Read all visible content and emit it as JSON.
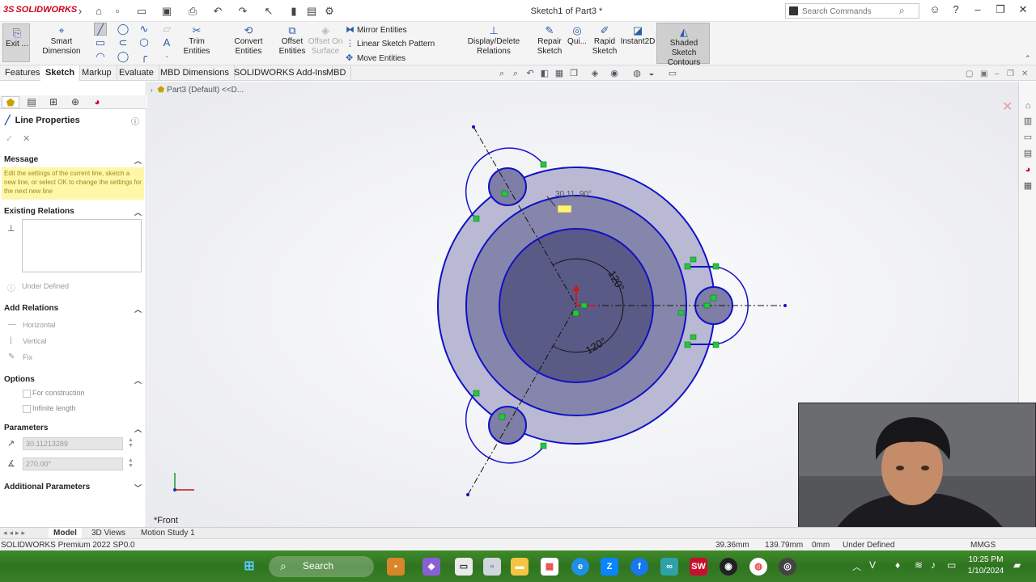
{
  "app": {
    "brand": "SOLIDWORKS",
    "document_title": "Sketch1 of Part3 *",
    "search_placeholder": "Search Commands"
  },
  "ribbon": {
    "exit_label": "Exit ...",
    "smart_dimension": "Smart Dimension",
    "trim_entities": "Trim Entities",
    "convert_entities": "Convert Entities",
    "offset_entities_line1": "Offset",
    "offset_entities_line2": "Entities",
    "offset_on_line1": "Offset On",
    "offset_on_line2": "Surface",
    "mirror_entities": "Mirror Entities",
    "linear_sketch_pattern": "Linear Sketch Pattern",
    "move_entities": "Move Entities",
    "display_delete_relations": "Display/Delete Relations",
    "repair_line1": "Repair",
    "repair_line2": "Sketch",
    "quick": "Qui...",
    "rapid_line1": "Rapid",
    "rapid_line2": "Sketch",
    "instant2d": "Instant2D",
    "shaded_line1": "Shaded Sketch",
    "shaded_line2": "Contours"
  },
  "tabs": [
    "Features",
    "Sketch",
    "Markup",
    "Evaluate",
    "MBD Dimensions",
    "SOLIDWORKS Add-Ins",
    "MBD"
  ],
  "active_tab": "Sketch",
  "tree": {
    "root": "Part3 (Default) <<D..."
  },
  "property_manager": {
    "title": "Line Properties",
    "message_header": "Message",
    "message_text": "Edit the settings of the current line, sketch a new line, or select OK to change the settings for the next new line",
    "existing_relations_header": "Existing Relations",
    "under_defined": "Under Defined",
    "add_relations_header": "Add Relations",
    "relations": [
      "Horizontal",
      "Vertical",
      "Fix"
    ],
    "options_header": "Options",
    "options": [
      "For construction",
      "Infinite length"
    ],
    "parameters_header": "Parameters",
    "length_value": "30.11213289",
    "angle_value": "270.00°",
    "additional_header": "Additional Parameters"
  },
  "sketch": {
    "dim_120_a": "120°",
    "dim_120_b": "120°",
    "cursor_readout": "30.11, 90°",
    "view_label": "*Front"
  },
  "bottom_tabs": [
    "Model",
    "3D Views",
    "Motion Study 1"
  ],
  "status": {
    "product": "SOLIDWORKS Premium 2022 SP0.0",
    "x": "39.36mm",
    "y": "139.79mm",
    "z": "0mm",
    "state": "Under Defined",
    "units": "MMGS"
  },
  "taskbar": {
    "search_label": "Search",
    "time": "10:25 PM",
    "date": "1/10/2024"
  },
  "colors": {
    "sketch_blue": "#1010c8",
    "fill_outer": "#b9b9d3",
    "fill_mid": "#8686ac",
    "fill_inner": "#5a5a86",
    "relation_green": "#22c93a"
  }
}
